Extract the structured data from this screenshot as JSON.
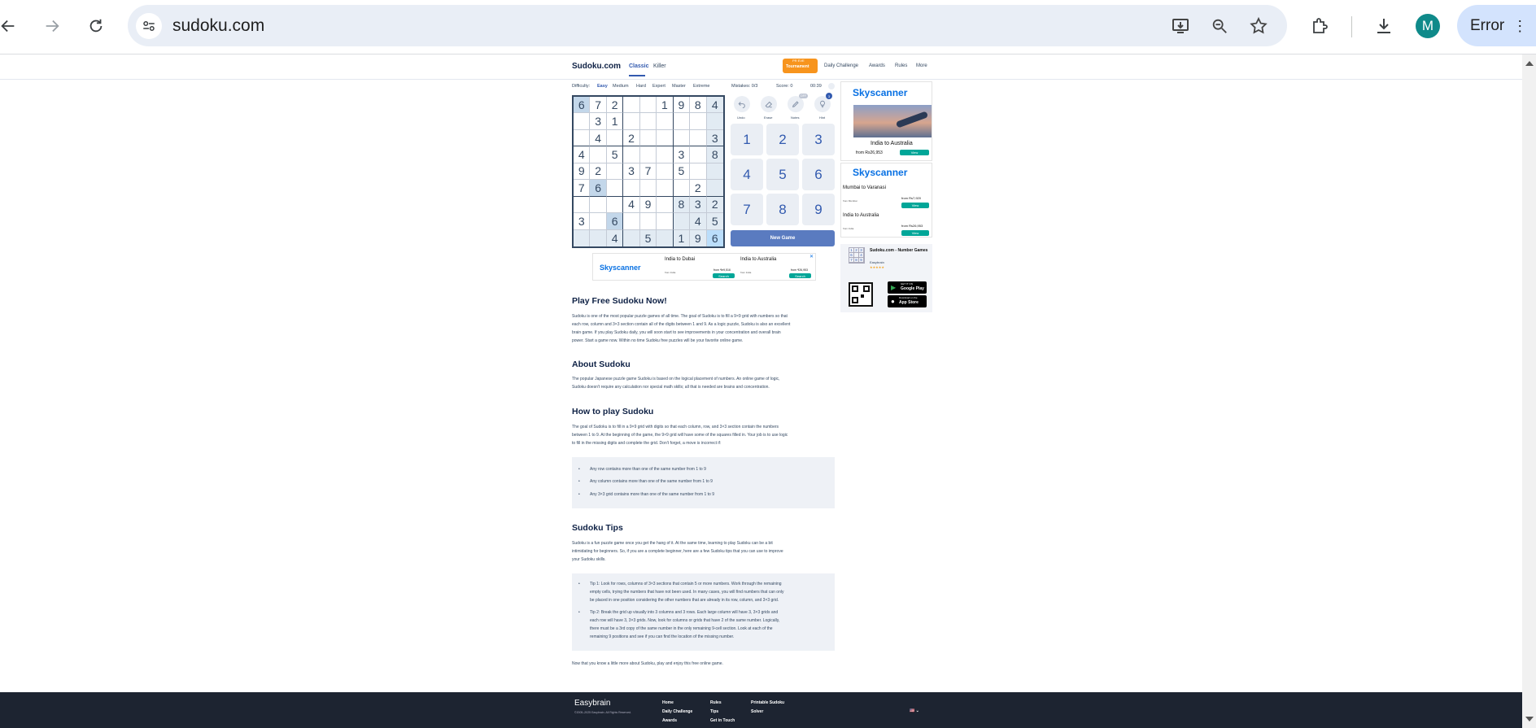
{
  "browser": {
    "url": "sudoku.com",
    "profile_initial": "M",
    "error_label": "Error"
  },
  "site": {
    "logo": "Sudoku.com",
    "tab_classic": "Classic",
    "tab_killer": "Killer",
    "tournament_badge": "Tournament",
    "tournament_top": "PR EVE",
    "nav": [
      "Daily Challenge",
      "Awards",
      "Rules",
      "More"
    ]
  },
  "game": {
    "difficulty_label": "Difficulty:",
    "difficulties": [
      "Easy",
      "Medium",
      "Hard",
      "Expert",
      "Master",
      "Extreme"
    ],
    "mistakes": "Mistakes: 0/3",
    "score": "Score: 0",
    "timer": "00:39",
    "board": [
      [
        "6",
        "7",
        "2",
        "",
        "",
        "1",
        "9",
        "8",
        "4"
      ],
      [
        "",
        "3",
        "1",
        "",
        "",
        "",
        "",
        "",
        ""
      ],
      [
        "",
        "4",
        "",
        "2",
        "",
        "",
        "",
        "",
        "3"
      ],
      [
        "4",
        "",
        "5",
        "",
        "",
        "",
        "3",
        "",
        "8"
      ],
      [
        "9",
        "2",
        "",
        "3",
        "7",
        "",
        "5",
        "",
        ""
      ],
      [
        "7",
        "6",
        "",
        "",
        "",
        "",
        "",
        "2",
        ""
      ],
      [
        "",
        "",
        "",
        "4",
        "9",
        "",
        "8",
        "3",
        "2"
      ],
      [
        "3",
        "",
        "6",
        "",
        "",
        "",
        "",
        "4",
        "5"
      ],
      [
        "",
        "",
        "4",
        "",
        "5",
        "",
        "1",
        "9",
        "6"
      ]
    ],
    "tools": [
      "Undo",
      "Erase",
      "Notes",
      "Hint"
    ],
    "notes_state": "OFF",
    "hint_count": "3",
    "numpad": [
      "1",
      "2",
      "3",
      "4",
      "5",
      "6",
      "7",
      "8",
      "9"
    ],
    "new_game": "New Game"
  },
  "ads": {
    "brand": "Skyscanner",
    "bottom": {
      "dest1": "India to Dubai",
      "dest2": "India to Australia",
      "from1": "from India",
      "price1": "from ₹e9,516",
      "from2": "from India",
      "price2": "from ₹26,953",
      "cta": "Search"
    },
    "side1": {
      "dest": "India to Australia",
      "price": "from Rs26,953",
      "cta": "View"
    },
    "side2": {
      "r1": "Mumbai to Varanasi",
      "r1sub": "from Mumbai",
      "r1price": "from Rs7,920",
      "r2": "India to Australia",
      "r2sub": "from India",
      "r2price": "from Rs26,953",
      "cta": "View"
    },
    "app": {
      "title": "Sudoku.com - Number Games",
      "dev": "Easybrain",
      "stars": "★★★★★",
      "mini": [
        "1",
        "2",
        "3",
        "6",
        "",
        "4",
        "7",
        "8",
        "9"
      ],
      "gp": "Google Play",
      "as": "App Store",
      "gp_pre": "GET IT ON",
      "as_pre": "Download on the"
    }
  },
  "content": {
    "h_play": "Play Free Sudoku Now!",
    "p_play": [
      "Sudoku is one of the most popular puzzle games of all time. The goal of Sudoku is to fill a 9×9 grid with numbers so that",
      "each row, column and 3×3 section contain all of the digits between 1 and 9. As a logic puzzle, Sudoku is also an excellent",
      "brain game. If you play Sudoku daily, you will soon start to see improvements in your concentration and overall brain",
      "power. Start a game now. Within no time Sudoku free puzzles will be your favorite online game."
    ],
    "h_about": "About Sudoku",
    "p_about": [
      "The popular Japanese puzzle game Sudoku is based on the logical placement of numbers. An online game of logic,",
      "Sudoku doesn't require any calculation nor special math skills; all that is needed are brains and concentration."
    ],
    "h_how": "How to play Sudoku",
    "p_how": [
      "The goal of Sudoku is to fill in a 9×9 grid with digits so that each column, row, and 3×3 section contain the numbers",
      "between 1 to 9. At the beginning of the game, the 9×9 grid will have some of the squares filled in. Your job is to use logic",
      "to fill in the missing digits and complete the grid. Don't forget, a move is incorrect if:"
    ],
    "rules": [
      "Any row contains more than one of the same number from 1 to 9",
      "Any column contains more than one of the same number from 1 to 9",
      "Any 3×3 grid contains more than one of the same number from 1 to 9"
    ],
    "h_tips": "Sudoku Tips",
    "p_tips": [
      "Sudoku is a fun puzzle game once you get the hang of it. At the same time, learning to play Sudoku can be a bit",
      "intimidating for beginners. So, if you are a complete beginner, here are a few Sudoku tips that you can use to improve",
      "your Sudoku skills."
    ],
    "tip1": [
      "Tip 1: Look for rows, columns of 3×3 sections that contain 5 or more numbers. Work through the remaining",
      "empty cells, trying the numbers that have not been used. In many cases, you will find numbers that can only",
      "be placed in one position considering the other numbers that are already in its row, column, and 3×3 grid."
    ],
    "tip2": [
      "Tip 2: Break the grid up visually into 3 columns and 3 rows. Each large column will have 3, 3×3 grids and",
      "each row will have 3, 3×3 grids. Now, look for columns or grids that have 2 of the same number. Logically,",
      "there must be a 3rd copy of the same number in the only remaining 9-cell section. Look at each of the",
      "remaining 9 positions and see if you can find the location of the missing number."
    ],
    "closing": "Now that you know a little more about Sudoku, play and enjoy this free online game."
  },
  "footer": {
    "brand": "Easybrain",
    "copyright": "©2005–2025 Easybrain. All Rights Reserved.",
    "links": [
      "Home",
      "Daily Challenge",
      "Awards",
      "Rules",
      "Tips",
      "Get in Touch",
      "Printable Sudoku",
      "Solver"
    ],
    "lang": "🇺🇸 ⌄"
  },
  "colors": {
    "accent": "#325aaf",
    "board_line": "#344861",
    "highlight": "#e2ebf3",
    "selected": "#bbdefb",
    "skyscanner": "#0770e3",
    "teal": "#00a698",
    "footer": "#1d2431",
    "badge": "#f7941d"
  }
}
